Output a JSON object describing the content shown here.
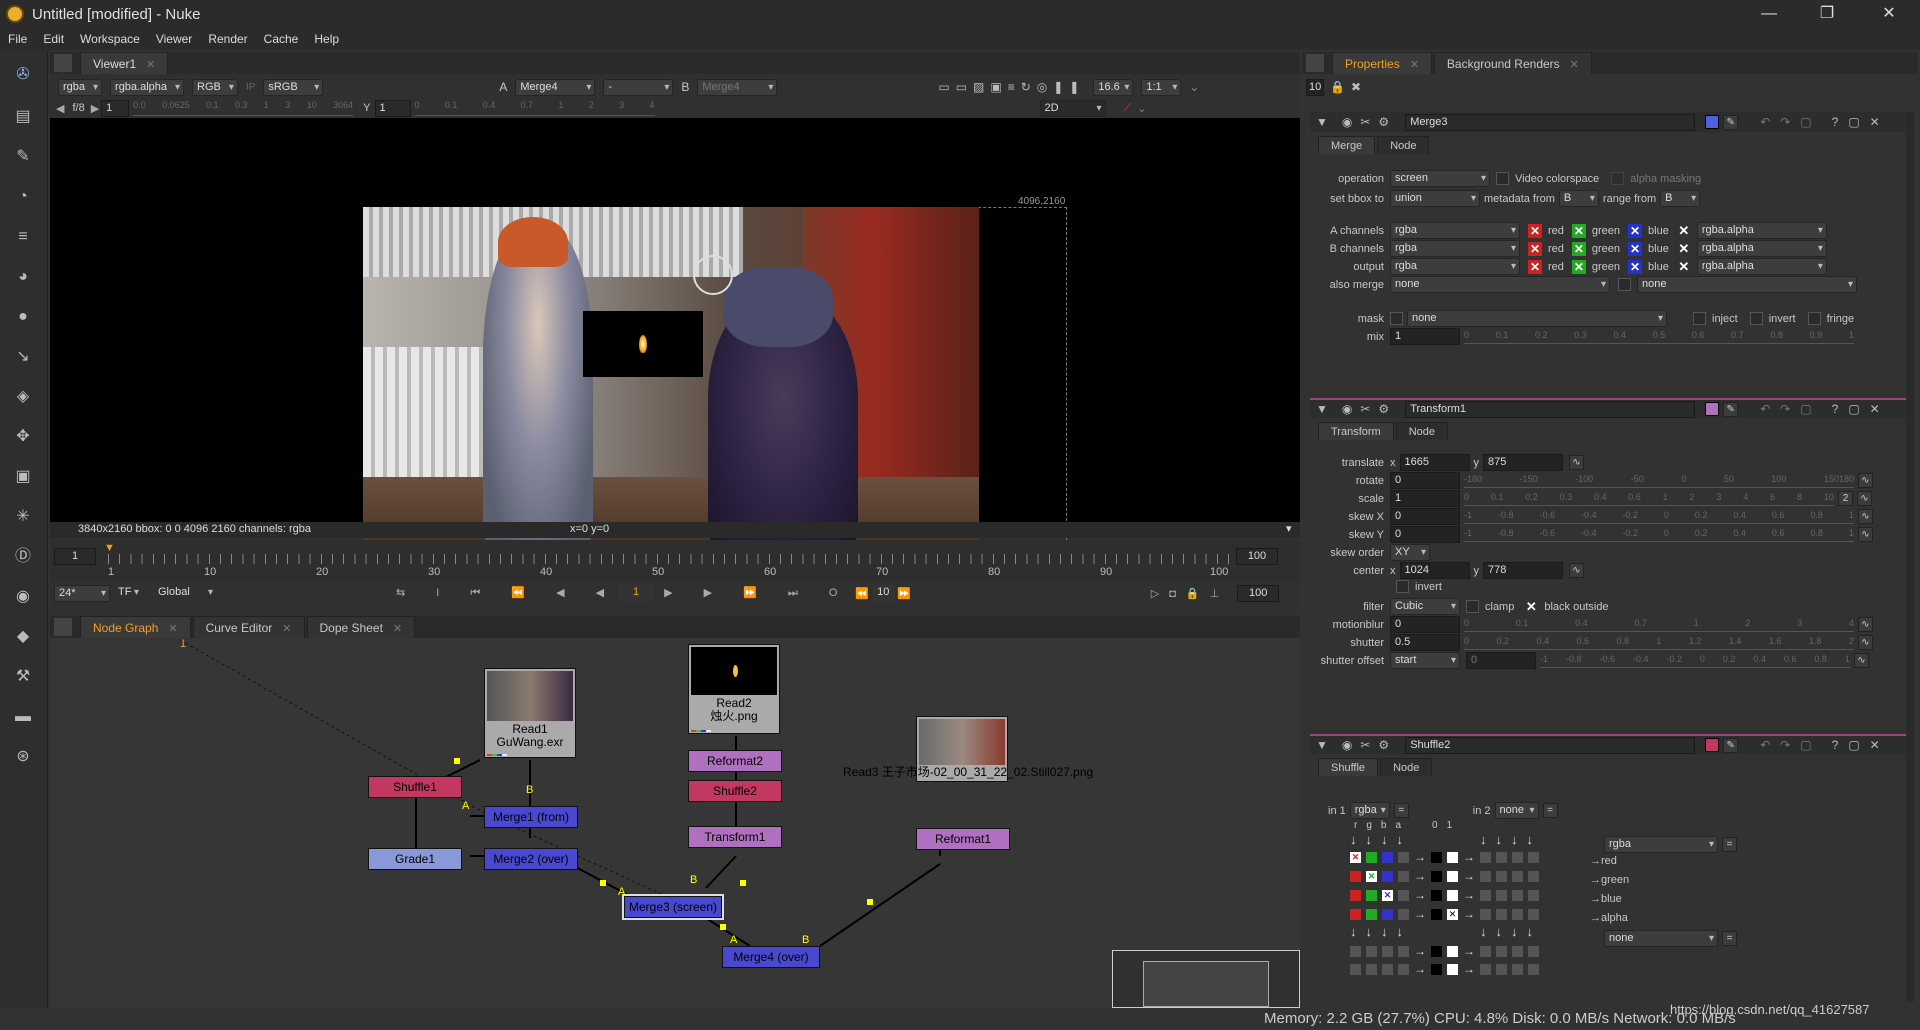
{
  "window": {
    "title": "Untitled [modified] - Nuke",
    "minimize": "—",
    "maximize": "❐",
    "close": "✕"
  },
  "menu": [
    "File",
    "Edit",
    "Workspace",
    "Viewer",
    "Render",
    "Cache",
    "Help"
  ],
  "viewer": {
    "tab": "Viewer1",
    "channels": "rgba",
    "alpha": "rgba.alpha",
    "colorspace_mode": "RGB",
    "lut": "sRGB",
    "input_a_label": "A",
    "input_a": "Merge4",
    "input_a_mode": "-",
    "input_b_label": "B",
    "input_b": "Merge4",
    "zoom": "16.6",
    "ratio": "1:1",
    "fstop": "f/8",
    "gain": "1",
    "y_label": "Y",
    "gamma": "1",
    "gain_ticks": [
      "0.0",
      "0.0625",
      "0.1",
      "0.3",
      "1",
      "3",
      "10",
      "3064"
    ],
    "gamma_ticks": [
      "0",
      "0.1",
      "0.4",
      "0.7",
      "1",
      "2",
      "3",
      "4"
    ],
    "view_mode": "2D",
    "format_label": "4096,2160",
    "status": "3840x2160  bbox: 0 0 4096 2160 channels: rgba",
    "coords": "x=0 y=0"
  },
  "timeline": {
    "start": "1",
    "end": "100",
    "ticks": [
      "1",
      "10",
      "20",
      "30",
      "40",
      "50",
      "60",
      "70",
      "80",
      "90",
      "100"
    ],
    "fps": "24*",
    "tf": "TF",
    "global": "Global",
    "current": "1",
    "step": "10",
    "end_field": "100",
    "start_field": "1",
    "end_field2": "100"
  },
  "bottom_tabs": [
    "Node Graph",
    "Curve Editor",
    "Dope Sheet"
  ],
  "nodes": {
    "read1": "Read1\nGuWang.exr",
    "read2": "Read2\n烛火.png",
    "read3": "Read3\n王子市场-02_00_31_22_02.Still027.png",
    "shuffle1": "Shuffle1",
    "shuffle2": "Shuffle2",
    "grade1": "Grade1",
    "merge1": "Merge1 (from)",
    "merge2": "Merge2 (over)",
    "merge3": "Merge3 (screen)",
    "merge4": "Merge4 (over)",
    "reformat1": "Reformat1",
    "reformat2": "Reformat2",
    "transform1": "Transform1",
    "a": "A",
    "b": "B",
    "topnum": "1"
  },
  "properties": {
    "tabs": [
      "Properties",
      "Background Renders"
    ],
    "max_panels": "10",
    "merge3": {
      "name": "Merge3",
      "tabs": [
        "Merge",
        "Node"
      ],
      "operation_label": "operation",
      "operation": "screen",
      "video_colorspace": "Video colorspace",
      "alpha_masking": "alpha masking",
      "bbox_label": "set bbox to",
      "bbox": "union",
      "metadata_label": "metadata from",
      "metadata": "B",
      "range_label": "range from",
      "range": "B",
      "a_channels_label": "A channels",
      "b_channels_label": "B channels",
      "output_label": "output",
      "channels_value": "rgba",
      "red": "red",
      "green": "green",
      "blue": "blue",
      "alpha_value": "rgba.alpha",
      "also_merge_label": "also merge",
      "also_merge": "none",
      "also_merge2": "none",
      "mask_label": "mask",
      "mask": "none",
      "inject": "inject",
      "invert": "invert",
      "fringe": "fringe",
      "mix_label": "mix",
      "mix": "1",
      "mix_ticks": [
        "0",
        "0.1",
        "0.2",
        "0.3",
        "0.4",
        "0.5",
        "0.6",
        "0.7",
        "0.8",
        "0.9",
        "1"
      ]
    },
    "transform1": {
      "name": "Transform1",
      "tabs": [
        "Transform",
        "Node"
      ],
      "translate_label": "translate",
      "x": "x",
      "y": "y",
      "tx": "1665",
      "ty": "875",
      "rotate_label": "rotate",
      "rotate": "0",
      "scale_label": "scale",
      "scale": "1",
      "skewx_label": "skew X",
      "skewx": "0",
      "skewy_label": "skew Y",
      "skewy": "0",
      "skew_order_label": "skew order",
      "skew_order": "XY",
      "center_label": "center",
      "cx": "1024",
      "cy": "778",
      "invert": "invert",
      "filter_label": "filter",
      "filter": "Cubic",
      "clamp": "clamp",
      "black_outside": "black outside",
      "motionblur_label": "motionblur",
      "motionblur": "0",
      "shutter_label": "shutter",
      "shutter": "0.5",
      "shutter_offset_label": "shutter offset",
      "shutter_offset": "start",
      "shutter_offset_val": "0",
      "rotate_ticks": [
        "-180",
        "-150",
        "-100",
        "-50",
        "0",
        "50",
        "100",
        "150180"
      ],
      "scale_ticks": [
        "0",
        "0.1",
        "0.2",
        "0.3",
        "0.4",
        "0.6",
        "1",
        "2",
        "3",
        "4",
        "6",
        "8",
        "10"
      ],
      "skew_ticks": [
        "-1",
        "-0.8",
        "-0.6",
        "-0.4",
        "-0.2",
        "0",
        "0.2",
        "0.4",
        "0.6",
        "0.8",
        "1"
      ],
      "mb_ticks": [
        "0",
        "0.1",
        "0.4",
        "0.7",
        "1",
        "2",
        "3",
        "4"
      ],
      "shutter_ticks": [
        "0",
        "0.2",
        "0.4",
        "0.6",
        "0.8",
        "1",
        "1.2",
        "1.4",
        "1.6",
        "1.8",
        "2"
      ],
      "so_ticks": [
        "-1",
        "-0.8",
        "-0.6",
        "-0.4",
        "-0.2",
        "0",
        "0.2",
        "0.4",
        "0.6",
        "0.8",
        "1"
      ]
    },
    "shuffle2": {
      "name": "Shuffle2",
      "tabs": [
        "Shuffle",
        "Node"
      ],
      "in1_label": "in 1",
      "in1": "rgba",
      "in2_label": "in 2",
      "in2": "none",
      "cols": [
        "r",
        "g",
        "b",
        "a",
        "0",
        "1"
      ],
      "out1": "rgba",
      "out2": "none",
      "outs": [
        "red",
        "green",
        "blue",
        "alpha"
      ]
    }
  },
  "statusbar": {
    "url": "https://blog.csdn.net/qq_41627587",
    "memory": "Memory: 2.2 GB (27.7%) CPU: 4.8% Disk: 0.0 MB/s Network: 0.0 MB/s"
  }
}
